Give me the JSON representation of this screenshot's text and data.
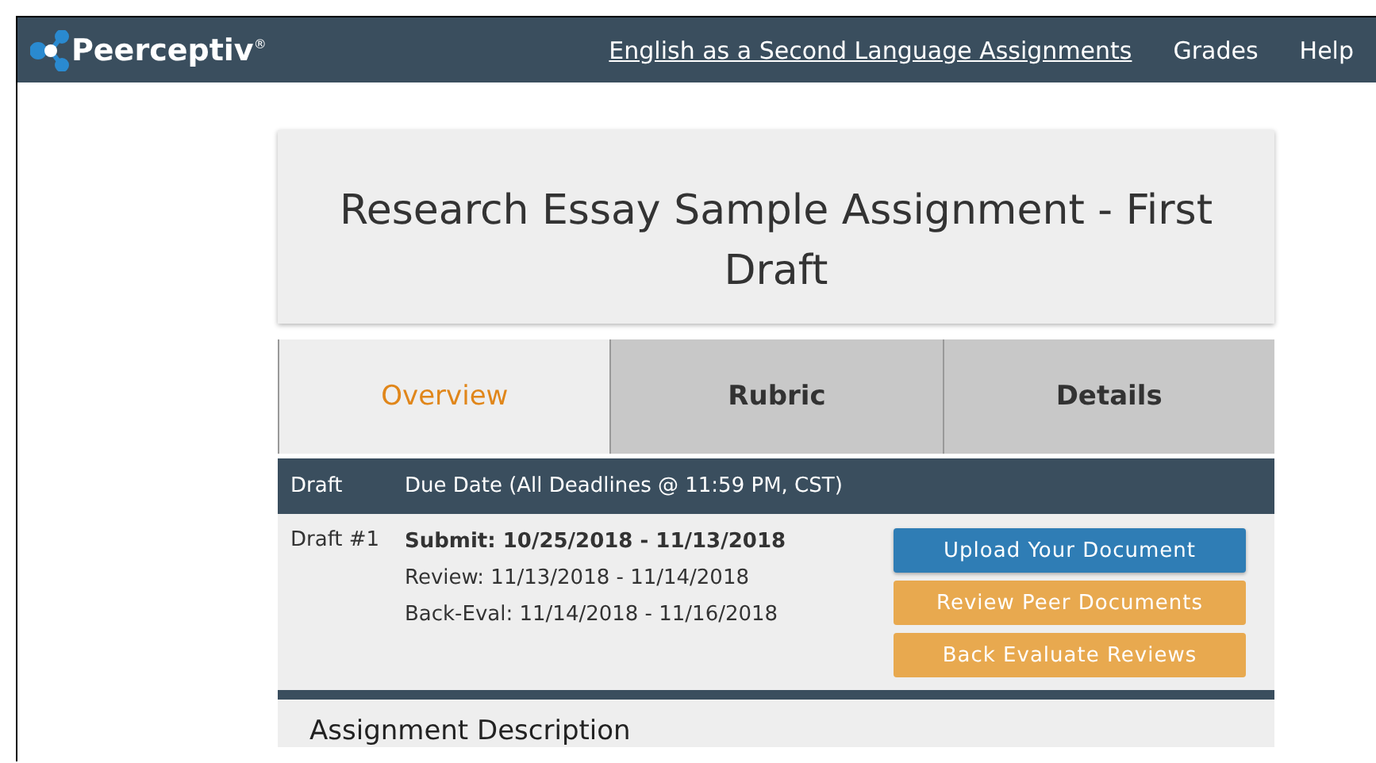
{
  "header": {
    "logo": "Peerceptiv",
    "logo_mark": "®",
    "nav": [
      {
        "label": "English as a Second Language Assignments",
        "kind": "link"
      },
      {
        "label": "Grades",
        "kind": "plain"
      },
      {
        "label": "Help",
        "kind": "plain"
      }
    ]
  },
  "assignment": {
    "title": "Research Essay Sample Assignment - First Draft"
  },
  "tabs": [
    {
      "label": "Overview",
      "selected": true
    },
    {
      "label": "Rubric",
      "selected": false
    },
    {
      "label": "Details",
      "selected": false
    }
  ],
  "schedule": {
    "columns": [
      "Draft",
      "Due Date (All Deadlines @ 11:59 PM, CST)"
    ],
    "rows": [
      {
        "draft": "Draft #1",
        "dates": [
          {
            "text": "Submit: 10/25/2018 - 11/13/2018",
            "current": true
          },
          {
            "text": "Review: 11/13/2018 - 11/14/2018",
            "current": false
          },
          {
            "text": "Back-Eval: 11/14/2018 - 11/16/2018",
            "current": false
          }
        ],
        "buttons": [
          {
            "label": "Upload Your Document",
            "kind": "primary"
          },
          {
            "label": "Review Peer Documents",
            "kind": "warning"
          },
          {
            "label": "Back Evaluate Reviews",
            "kind": "warning"
          }
        ]
      }
    ]
  },
  "description": {
    "heading": "Assignment Description"
  }
}
